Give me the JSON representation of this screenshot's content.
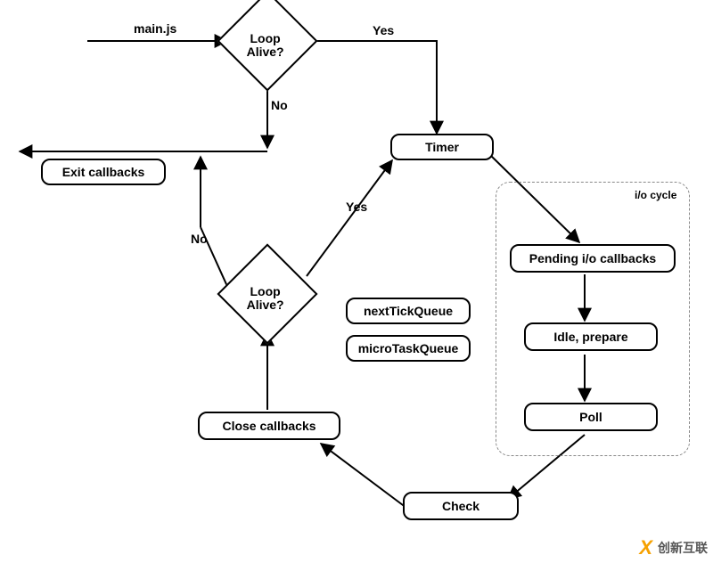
{
  "diagram": {
    "entry_label": "main.js",
    "decisions": {
      "loop_alive_top": "Loop\nAlive?",
      "loop_alive_bottom": "Loop\nAlive?"
    },
    "edges": {
      "top_yes": "Yes",
      "top_no": "No",
      "bottom_yes": "Yes",
      "bottom_no": "No"
    },
    "nodes": {
      "exit_callbacks": "Exit callbacks",
      "timer": "Timer",
      "pending_io": "Pending i/o callbacks",
      "idle_prepare": "Idle, prepare",
      "poll": "Poll",
      "check": "Check",
      "close_callbacks": "Close callbacks",
      "next_tick_queue": "nextTickQueue",
      "micro_task_queue": "microTaskQueue"
    },
    "groups": {
      "io_cycle_title": "i/o cycle"
    }
  },
  "watermark": {
    "logo": "X",
    "text": "创新互联"
  }
}
